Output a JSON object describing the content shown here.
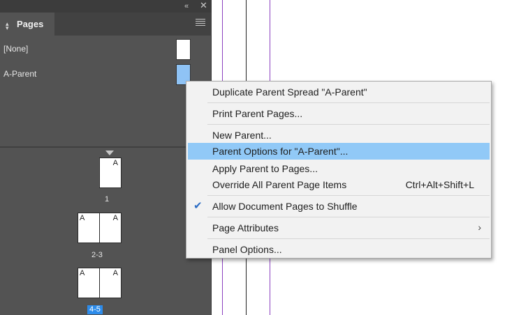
{
  "colors": {
    "panel_bg": "#535353",
    "highlight": "#91c9f7",
    "master_thumb_selected": "#8fc3f5",
    "guide_purple": "#8a3fbf",
    "page_selected_badge": "#2d8ceb"
  },
  "panel": {
    "collapse_icon": "double-chevron-left-icon",
    "close_icon": "close-icon",
    "tab_label": "Pages",
    "menu_icon": "hamburger-menu-icon",
    "masters": [
      {
        "label": "[None]"
      },
      {
        "label": "A-Parent"
      }
    ],
    "pages": [
      {
        "number": "1",
        "letters": [
          "A"
        ],
        "selected": false
      },
      {
        "number": "2-3",
        "letters": [
          "A",
          "A"
        ],
        "selected": false
      },
      {
        "number": "4-5",
        "letters": [
          "A",
          "A"
        ],
        "selected": true
      }
    ]
  },
  "context_menu": {
    "items": [
      {
        "label": "Duplicate Parent Spread \"A-Parent\""
      },
      {
        "label": "Print Parent Pages..."
      },
      {
        "label": "New Parent..."
      },
      {
        "label": "Parent Options for \"A-Parent\"...",
        "highlighted": true
      },
      {
        "label": "Apply Parent to Pages..."
      },
      {
        "label": "Override All Parent Page Items",
        "shortcut": "Ctrl+Alt+Shift+L"
      },
      {
        "label": "Allow Document Pages to Shuffle",
        "checked": true
      },
      {
        "label": "Page Attributes",
        "submenu": true
      },
      {
        "label": "Panel Options..."
      }
    ]
  }
}
